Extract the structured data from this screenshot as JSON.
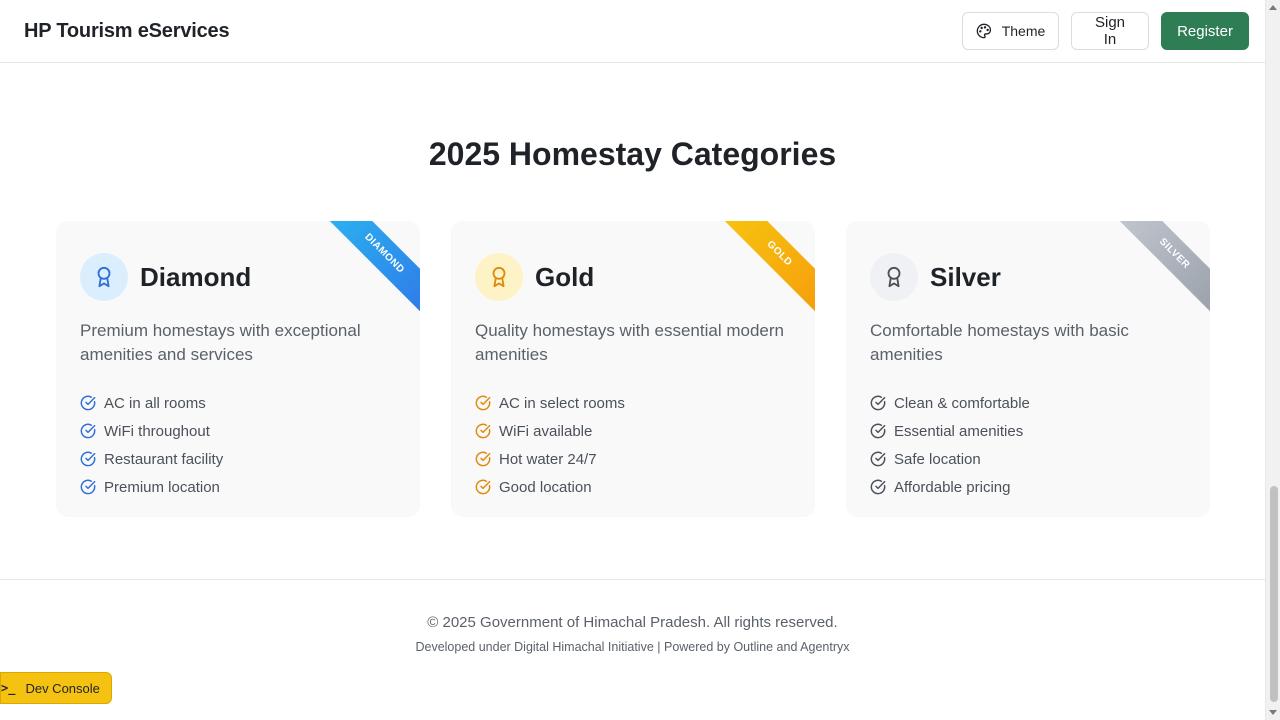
{
  "header": {
    "brand": "HP Tourism eServices",
    "theme_label": "Theme",
    "signin_label": "Sign In",
    "register_label": "Register"
  },
  "section": {
    "title": "2025 Homestay Categories"
  },
  "cards": [
    {
      "name": "Diamond",
      "ribbon": "DIAMOND",
      "description": "Premium homestays with exceptional amenities and services",
      "accent": "#2f6fd6",
      "icon_bg": "#dbeefd",
      "features": [
        "AC in all rooms",
        "WiFi throughout",
        "Restaurant facility",
        "Premium location"
      ]
    },
    {
      "name": "Gold",
      "ribbon": "GOLD",
      "description": "Quality homestays with essential modern amenities",
      "accent": "#e08a0b",
      "icon_bg": "#fdf3c7",
      "features": [
        "AC in select rooms",
        "WiFi available",
        "Hot water 24/7",
        "Good location"
      ]
    },
    {
      "name": "Silver",
      "ribbon": "SILVER",
      "description": "Comfortable homestays with basic amenities",
      "accent": "#4b5159",
      "icon_bg": "#eff1f4",
      "features": [
        "Clean & comfortable",
        "Essential amenities",
        "Safe location",
        "Affordable pricing"
      ]
    }
  ],
  "footer": {
    "copyright": "© 2025 Government of Himachal Pradesh. All rights reserved.",
    "developed": "Developed under Digital Himachal Initiative | Powered by Outline and Agentryx"
  },
  "dev_console": {
    "prompt": ">_",
    "label": "Dev Console"
  },
  "colors": {
    "register_bg": "#2e7d55",
    "dev_console_bg": "#f5c211"
  }
}
